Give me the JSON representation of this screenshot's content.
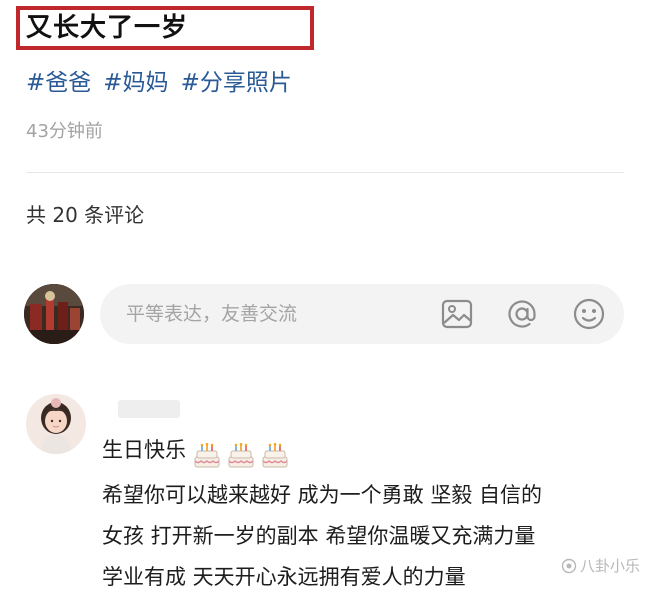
{
  "post": {
    "title": "又长大了一岁",
    "tags": [
      "#爸爸",
      "#妈妈",
      "#分享照片"
    ],
    "time": "43分钟前"
  },
  "comments": {
    "count_text": "共 20 条评论"
  },
  "composer": {
    "placeholder": "平等表达，友善交流",
    "icons": [
      "image-icon",
      "mention-icon",
      "emoji-icon"
    ]
  },
  "comment_item": {
    "lines": [
      "生日快乐",
      "希望你可以越来越好 成为一个勇敢 坚毅 自信的",
      "女孩 打开新一岁的副本 希望你温暖又充满力量",
      "学业有成 天天开心永远拥有爱人的力量"
    ],
    "emoji": [
      "birthday-cake",
      "birthday-cake",
      "birthday-cake"
    ]
  },
  "watermark": {
    "text": "八卦小乐"
  },
  "colors": {
    "highlight_border": "#c0272d",
    "tag": "#2a5a96",
    "muted": "#a3a3a3"
  }
}
